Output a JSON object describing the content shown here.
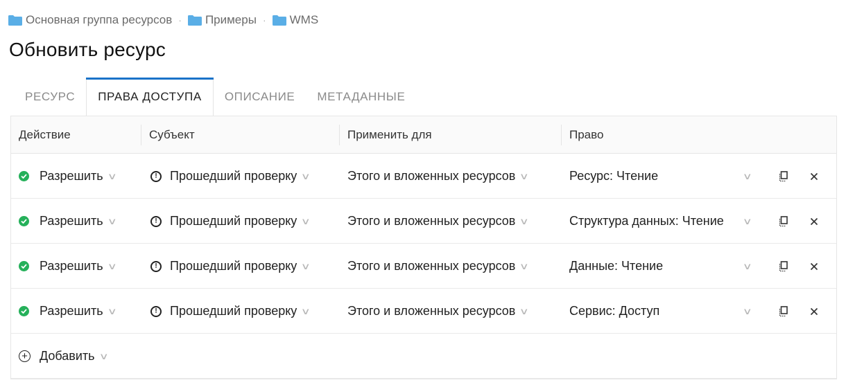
{
  "breadcrumb": {
    "items": [
      "Основная группа ресурсов",
      "Примеры",
      "WMS"
    ],
    "separator": "·"
  },
  "title": "Обновить ресурс",
  "tabs": [
    {
      "label": "РЕСУРС",
      "active": false
    },
    {
      "label": "ПРАВА ДОСТУПА",
      "active": true
    },
    {
      "label": "ОПИСАНИЕ",
      "active": false
    },
    {
      "label": "МЕТАДАННЫЕ",
      "active": false
    }
  ],
  "table": {
    "headers": [
      "Действие",
      "Субъект",
      "Применить для",
      "Право"
    ],
    "rows": [
      {
        "action": "Разрешить",
        "subject": "Прошедший проверку",
        "scope": "Этого и вложенных ресурсов",
        "right": "Ресурс: Чтение"
      },
      {
        "action": "Разрешить",
        "subject": "Прошедший проверку",
        "scope": "Этого и вложенных ресурсов",
        "right": "Структура данных: Чтение"
      },
      {
        "action": "Разрешить",
        "subject": "Прошедший проверку",
        "scope": "Этого и вложенных ресурсов",
        "right": "Данные: Чтение"
      },
      {
        "action": "Разрешить",
        "subject": "Прошедший проверку",
        "scope": "Этого и вложенных ресурсов",
        "right": "Сервис: Доступ"
      }
    ],
    "add_label": "Добавить"
  },
  "icons": {
    "folder": "folder-icon",
    "allow": "check-circle-icon",
    "subject": "info-circle-icon",
    "dropdown": "chevron-down-icon",
    "copy": "copy-icon",
    "delete": "close-icon",
    "add": "plus-circle-icon"
  },
  "colors": {
    "accent": "#1a73c8",
    "folder": "#5aaee6",
    "allow": "#25b05a"
  }
}
